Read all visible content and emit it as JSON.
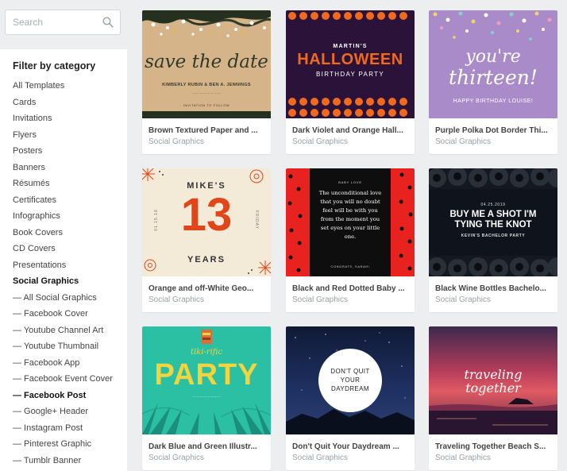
{
  "search": {
    "placeholder": "Search"
  },
  "filter": {
    "title": "Filter by category",
    "items": [
      {
        "label": "All Templates",
        "bold": false
      },
      {
        "label": "Cards",
        "bold": false
      },
      {
        "label": "Invitations",
        "bold": false
      },
      {
        "label": "Flyers",
        "bold": false
      },
      {
        "label": "Posters",
        "bold": false
      },
      {
        "label": "Banners",
        "bold": false
      },
      {
        "label": "Résumés",
        "bold": false
      },
      {
        "label": "Certificates",
        "bold": false
      },
      {
        "label": "Infographics",
        "bold": false
      },
      {
        "label": "Book Covers",
        "bold": false
      },
      {
        "label": "CD Covers",
        "bold": false
      },
      {
        "label": "Presentations",
        "bold": false
      },
      {
        "label": "Social Graphics",
        "bold": true
      },
      {
        "label": "— All Social Graphics",
        "bold": false
      },
      {
        "label": "— Facebook Cover",
        "bold": false
      },
      {
        "label": "— Youtube Channel Art",
        "bold": false
      },
      {
        "label": "— Youtube Thumbnail",
        "bold": false
      },
      {
        "label": "— Facebook App",
        "bold": false
      },
      {
        "label": "— Facebook Event Cover",
        "bold": false
      },
      {
        "label": "— Facebook Post",
        "bold": true
      },
      {
        "label": "— Google+ Header",
        "bold": false
      },
      {
        "label": "— Instagram Post",
        "bold": false
      },
      {
        "label": "— Pinterest Graphic",
        "bold": false
      },
      {
        "label": "— Tumblr Banner",
        "bold": false
      }
    ]
  },
  "templates": [
    {
      "title": "Brown Textured Paper and ...",
      "category": "Social Graphics",
      "art": {
        "line1": "save the date",
        "line2": "KIMBERLY RUBIN & BEN A. JENNINGS",
        "line3": "INVITATION TO FOLLOW"
      }
    },
    {
      "title": "Dark Violet and Orange Hall...",
      "category": "Social Graphics",
      "art": {
        "line1": "MARTIN'S",
        "line2": "HALLOWEEN",
        "line3": "BIRTHDAY PARTY"
      }
    },
    {
      "title": "Purple Polka Dot Border Thi...",
      "category": "Social Graphics",
      "art": {
        "line1": "you're",
        "line2": "thirteen!",
        "line3": "HAPPY BIRTHDAY LOUISE!"
      }
    },
    {
      "title": "Orange and off-White Geo...",
      "category": "Social Graphics",
      "art": {
        "line1": "MIKE'S",
        "line2": "13",
        "line3": "YEARS",
        "side_left": "01.15.18",
        "side_right": "FRIDAY"
      }
    },
    {
      "title": "Black and Red Dotted Baby ...",
      "category": "Social Graphics",
      "art": {
        "line1": "BABY LOVE",
        "line2": "The unconditional love that you will no doubt feel will be with you from the moment you set eyes on your little one.",
        "line3": "CONGRATS, SARAH!"
      }
    },
    {
      "title": "Black Wine Bottles Bachelo...",
      "category": "Social Graphics",
      "art": {
        "line1": "04.25.2019",
        "line2": "BUY ME A SHOT I'M TYING THE KNOT",
        "line3": "KEVIN'S BACHELOR PARTY"
      }
    },
    {
      "title": "Dark Blue and Green Illustr...",
      "category": "Social Graphics",
      "art": {
        "line1": "tiki-rific",
        "line2": "PARTY"
      }
    },
    {
      "title": "Don't Quit Your Daydream ...",
      "category": "Social Graphics",
      "art": {
        "line1": "DON'T QUIT YOUR DAYDREAM"
      }
    },
    {
      "title": "Traveling Together Beach S...",
      "category": "Social Graphics",
      "art": {
        "line1": "traveling together"
      }
    }
  ],
  "colors": {
    "kraft": "#d7b58a",
    "halloween_bg": "#2a1238",
    "halloween_orange": "#ef6a1e",
    "lilac": "#a88bc8",
    "cream": "#f4ead8",
    "geo_orange": "#e0461a",
    "dotted_red": "#e8231f",
    "wine_black": "#141820",
    "tiki_teal": "#2bbfa3",
    "tiki_yellow": "#f2d43c",
    "night_blue": "#1b2a4e",
    "sunset_pink": "#d8466b"
  }
}
